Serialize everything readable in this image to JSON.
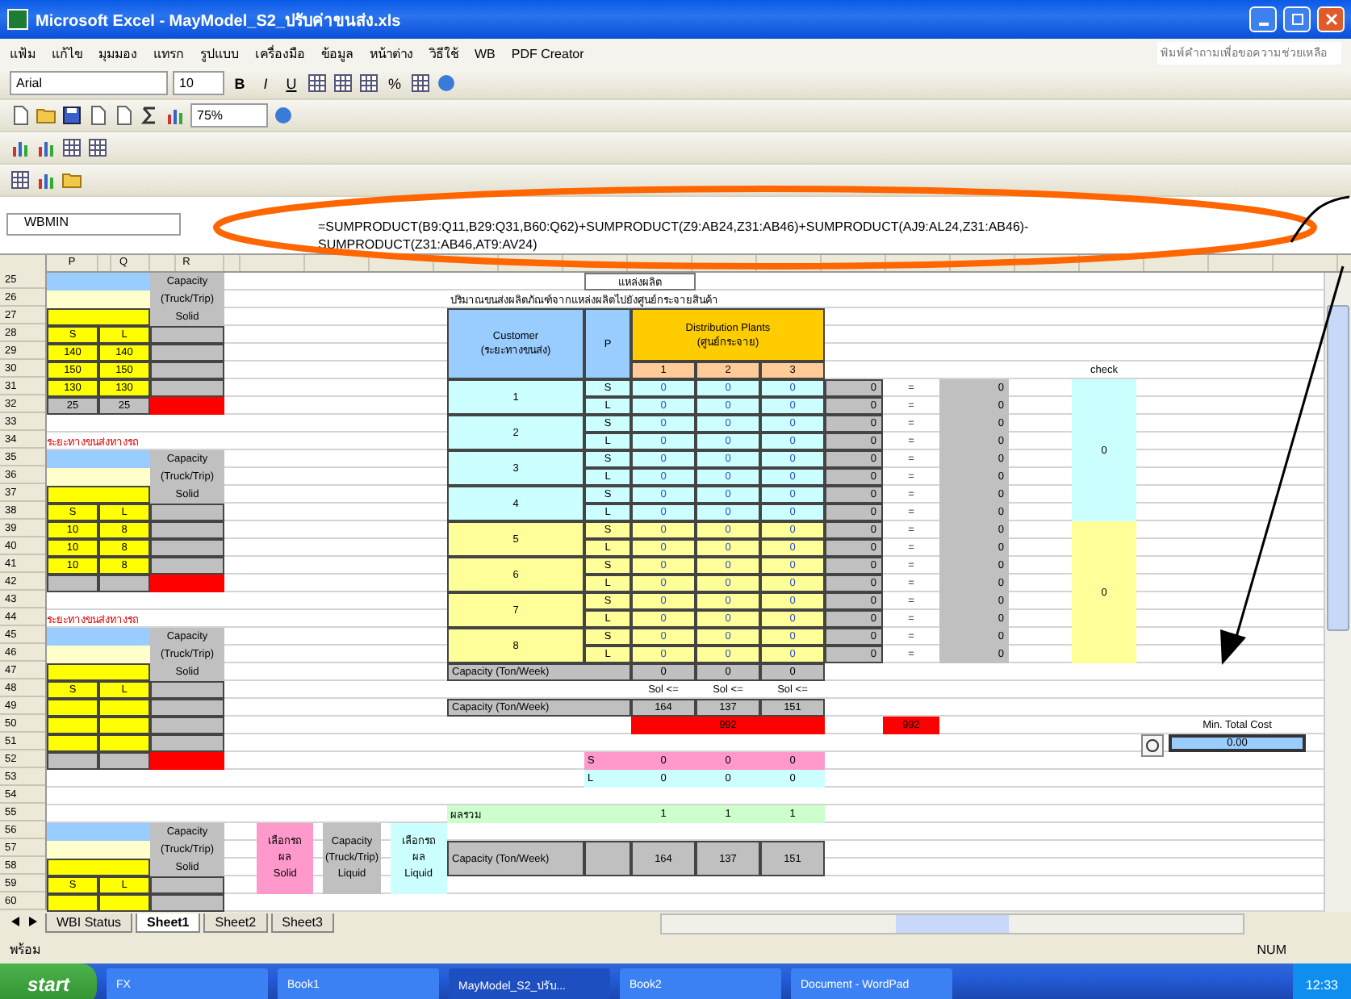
{
  "window": {
    "title": "Microsoft Excel - MayModel_S2_ปรับค่าขนส่ง.xls"
  },
  "menu": [
    "แฟ้ม",
    "แก้ไข",
    "มุมมอง",
    "แทรก",
    "รูปแบบ",
    "เครื่องมือ",
    "ข้อมูล",
    "หน้าต่าง",
    "วิธีใช้",
    "WB",
    "PDF Creator"
  ],
  "help_box": {
    "placeholder": "พิมพ์คำถามเพื่อขอความช่วยเหลือ"
  },
  "toolbar": {
    "font": "Arial",
    "size": "10",
    "bold": "B",
    "italic": "I",
    "underline": "U",
    "percent": "%",
    "zoom": "75%"
  },
  "formula_bar": {
    "name_box": "WBMIN",
    "formula": "=SUMPRODUCT(B9:Q11,B29:Q31,B60:Q62)+SUMPRODUCT(Z9:AB24,Z31:AB46)+SUMPRODUCT(AJ9:AL24,Z31:AB46)-SUMPRODUCT(Z31:AB46,AT9:AV24)"
  },
  "columns": [
    "P",
    "Q",
    "R"
  ],
  "rows": [
    "25",
    "26",
    "27",
    "28",
    "29",
    "30",
    "31",
    "32",
    "33",
    "34",
    "35",
    "36",
    "37",
    "38",
    "39",
    "40",
    "41",
    "42",
    "43",
    "44",
    "45",
    "46",
    "47",
    "48",
    "49",
    "50",
    "51",
    "52",
    "53",
    "54",
    "55",
    "56",
    "57",
    "58",
    "59",
    "60"
  ],
  "left_blocks": [
    {
      "header": [
        "Capacity",
        "(Truck/Trip)",
        "Solid"
      ],
      "sl": [
        "S",
        "L"
      ],
      "values": [
        [
          "140",
          "140"
        ],
        [
          "150",
          "150"
        ],
        [
          "130",
          "130"
        ]
      ],
      "totals": [
        "25",
        "25"
      ]
    },
    {
      "title": "ระยะทางขนส่งทางรถ",
      "header": [
        "Capacity",
        "(Truck/Trip)",
        "Solid"
      ],
      "sl": [
        "S",
        "L"
      ],
      "values": [
        [
          "10",
          "8"
        ],
        [
          "10",
          "8"
        ],
        [
          "10",
          "8"
        ]
      ]
    },
    {
      "title": "ระยะทางขนส่งทางรถ",
      "header": [
        "Capacity",
        "(Truck/Trip)",
        "Solid"
      ],
      "sl": [
        "S",
        "L"
      ]
    },
    {
      "header": [
        "Capacity",
        "(Truck/Trip)",
        "Solid"
      ],
      "sl": [
        "S",
        "L"
      ],
      "extras": [
        {
          "lines": [
            "เลือกรถ",
            "ผล",
            "Solid"
          ],
          "color": "#ff99cc"
        },
        {
          "lines": [
            "Capacity",
            "(Truck/Trip)",
            "Liquid"
          ],
          "color": "#c0c0c0"
        },
        {
          "lines": [
            "เลือกรถ",
            "ผล",
            "Liquid"
          ],
          "color": "#ccffff"
        }
      ]
    }
  ],
  "center": {
    "source_label": "แหล่งผลิต",
    "caption": "ปริมาณขนส่งผลิตภัณฑ์จากแหล่งผลิตไปยังศูนย์กระจายสินค้า",
    "customer_header": [
      "Customer",
      "(ระยะทางขนส่ง)"
    ],
    "p_header": "P",
    "plant_header": [
      "Distribution Plants",
      "(ศูนย์กระจาย)"
    ],
    "plants": [
      "1",
      "2",
      "3"
    ],
    "customers": [
      {
        "label": "1",
        "color": "#ccffff",
        "rows": [
          {
            "p": "S",
            "values": [
              "0",
              "0",
              "0"
            ],
            "total": "0",
            "eq": "=",
            "rhs": "0"
          },
          {
            "p": "L",
            "values": [
              "0",
              "0",
              "0"
            ],
            "total": "0",
            "eq": "=",
            "rhs": "0"
          }
        ]
      },
      {
        "label": "2",
        "color": "#ccffff",
        "rows": [
          {
            "p": "S",
            "values": [
              "0",
              "0",
              "0"
            ],
            "total": "0",
            "eq": "=",
            "rhs": "0"
          },
          {
            "p": "L",
            "values": [
              "0",
              "0",
              "0"
            ],
            "total": "0",
            "eq": "=",
            "rhs": "0"
          }
        ]
      },
      {
        "label": "3",
        "color": "#ccffff",
        "rows": [
          {
            "p": "S",
            "values": [
              "0",
              "0",
              "0"
            ],
            "total": "0",
            "eq": "=",
            "rhs": "0"
          },
          {
            "p": "L",
            "values": [
              "0",
              "0",
              "0"
            ],
            "total": "0",
            "eq": "=",
            "rhs": "0"
          }
        ]
      },
      {
        "label": "4",
        "color": "#ccffff",
        "rows": [
          {
            "p": "S",
            "values": [
              "0",
              "0",
              "0"
            ],
            "total": "0",
            "eq": "=",
            "rhs": "0"
          },
          {
            "p": "L",
            "values": [
              "0",
              "0",
              "0"
            ],
            "total": "0",
            "eq": "=",
            "rhs": "0"
          }
        ]
      },
      {
        "label": "5",
        "color": "#ffff99",
        "rows": [
          {
            "p": "S",
            "values": [
              "0",
              "0",
              "0"
            ],
            "total": "0",
            "eq": "=",
            "rhs": "0"
          },
          {
            "p": "L",
            "values": [
              "0",
              "0",
              "0"
            ],
            "total": "0",
            "eq": "=",
            "rhs": "0"
          }
        ]
      },
      {
        "label": "6",
        "color": "#ffff99",
        "rows": [
          {
            "p": "S",
            "values": [
              "0",
              "0",
              "0"
            ],
            "total": "0",
            "eq": "=",
            "rhs": "0"
          },
          {
            "p": "L",
            "values": [
              "0",
              "0",
              "0"
            ],
            "total": "0",
            "eq": "=",
            "rhs": "0"
          }
        ]
      },
      {
        "label": "7",
        "color": "#ffff99",
        "rows": [
          {
            "p": "S",
            "values": [
              "0",
              "0",
              "0"
            ],
            "total": "0",
            "eq": "=",
            "rhs": "0"
          },
          {
            "p": "L",
            "values": [
              "0",
              "0",
              "0"
            ],
            "total": "0",
            "eq": "=",
            "rhs": "0"
          }
        ]
      },
      {
        "label": "8",
        "color": "#ffff99",
        "rows": [
          {
            "p": "S",
            "values": [
              "0",
              "0",
              "0"
            ],
            "total": "0",
            "eq": "=",
            "rhs": "0"
          },
          {
            "p": "L",
            "values": [
              "0",
              "0",
              "0"
            ],
            "total": "0",
            "eq": "=",
            "rhs": "0"
          }
        ]
      }
    ],
    "capacity_row": {
      "label": "Capacity (Ton/Week)",
      "values": [
        "0",
        "0",
        "0"
      ]
    },
    "constraint_row": [
      "Sol <=",
      "Sol <=",
      "Sol <="
    ],
    "capacity_row2": {
      "label": "Capacity (Ton/Week)",
      "values": [
        "164",
        "137",
        "151"
      ]
    },
    "total_bar": "992",
    "total_cell": "992",
    "s_row": {
      "label": "S",
      "values": [
        "0",
        "0",
        "0"
      ]
    },
    "l_row": {
      "label": "L",
      "values": [
        "0",
        "0",
        "0"
      ]
    },
    "sum_row": {
      "label": "ผลรวม",
      "values": [
        "1",
        "1",
        "1"
      ]
    },
    "capacity_row3": {
      "label": "Capacity (Ton/Week)",
      "values": [
        "164",
        "137",
        "151"
      ]
    }
  },
  "check": {
    "label": "check",
    "values": [
      {
        "value": "0",
        "color": "#ccffff"
      },
      {
        "value": "0",
        "color": "#ffff99"
      }
    ]
  },
  "min_cost": {
    "label": "Min. Total Cost",
    "value": "0.00"
  },
  "sheet_tabs": [
    {
      "label": "WBI Status",
      "selected": false
    },
    {
      "label": "Sheet1",
      "selected": true
    },
    {
      "label": "Sheet2",
      "selected": false
    },
    {
      "label": "Sheet3",
      "selected": false
    }
  ],
  "status_bar": {
    "mode": "พร้อม",
    "num": "NUM"
  },
  "taskbar": {
    "start": "start",
    "items": [
      {
        "label": "FX",
        "selected": false
      },
      {
        "label": "Book1",
        "selected": false
      },
      {
        "label": "MayModel_S2_ปรับ...",
        "selected": true
      },
      {
        "label": "Book2",
        "selected": false
      },
      {
        "label": "Document - WordPad",
        "selected": false
      }
    ],
    "clock": "12:33"
  }
}
